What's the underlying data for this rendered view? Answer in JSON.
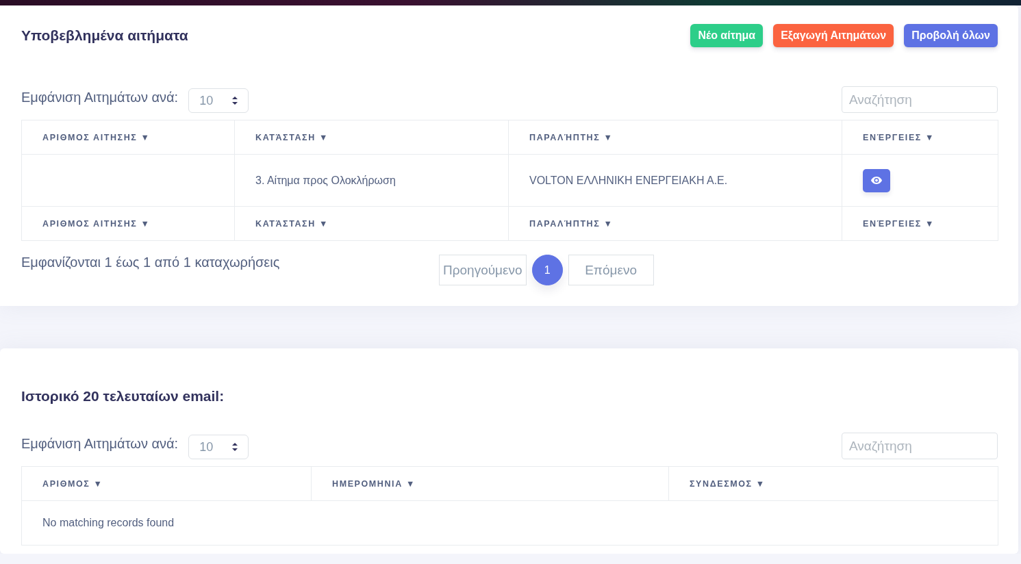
{
  "cards": [
    {
      "title": "Υποβεβλημένα αιτήματα",
      "buttons": [
        {
          "label": "Νέο αίτημα",
          "color": "#2dce89"
        },
        {
          "label": "Εξαγωγή Αιτημάτων",
          "color": "#fb6340"
        },
        {
          "label": "Προβολή όλων",
          "color": "#5e72e4"
        }
      ],
      "length_label": "Εμφάνιση Αιτημάτων ανά:",
      "length_value": "10",
      "search": {
        "placeholder": "Αναζήτηση"
      },
      "columns": [
        "ΑΡΙΘΜΟΣ ΑΙΤΗΣΗΣ ▼",
        "ΚΑΤΆΣΤΑΣΗ ▼",
        "ΠΑΡΑΛΉΠΤΗΣ ▼",
        "ΕΝΈΡΓΕΙΕΣ ▼"
      ],
      "rows": [
        {
          "kind": "data",
          "cells": [
            "",
            "3. Αίτημα προς Ολοκλήρωση",
            "VOLTON ΕΛΛΗΝΙΚΗ ΕΝΕΡΓΕΙΑΚΗ Α.Ε."
          ],
          "view_button": true
        }
      ],
      "footer_columns": [
        "ΑΡΙΘΜΟΣ ΑΙΤΗΣΗΣ ▼",
        "ΚΑΤΆΣΤΑΣΗ ▼",
        "ΠΑΡΑΛΉΠΤΗΣ ▼",
        "ΕΝΈΡΓΕΙΕΣ ▼"
      ],
      "info": "Εμφανίζονται 1 έως 1 από 1 καταχωρήσεις",
      "pagination": {
        "prev": "Προηγούμενο",
        "pages": [
          {
            "label": "1",
            "selected": true
          }
        ],
        "next": "Επόμενο"
      }
    },
    {
      "title": "Ιστορικό 20 τελευταίων email:",
      "length_label": "Εμφάνιση Αιτημάτων ανά:",
      "length_value": "10",
      "search": {
        "placeholder": "Αναζήτηση"
      },
      "columns": [
        "ΑΡΙΘΜΟΣ ▼",
        "ΗΜΕΡΟΜΗΝΙΑ ▼",
        "ΣΥΝΔΕΣΜΟΣ ▼"
      ],
      "empty_message": "No matching records found"
    }
  ]
}
